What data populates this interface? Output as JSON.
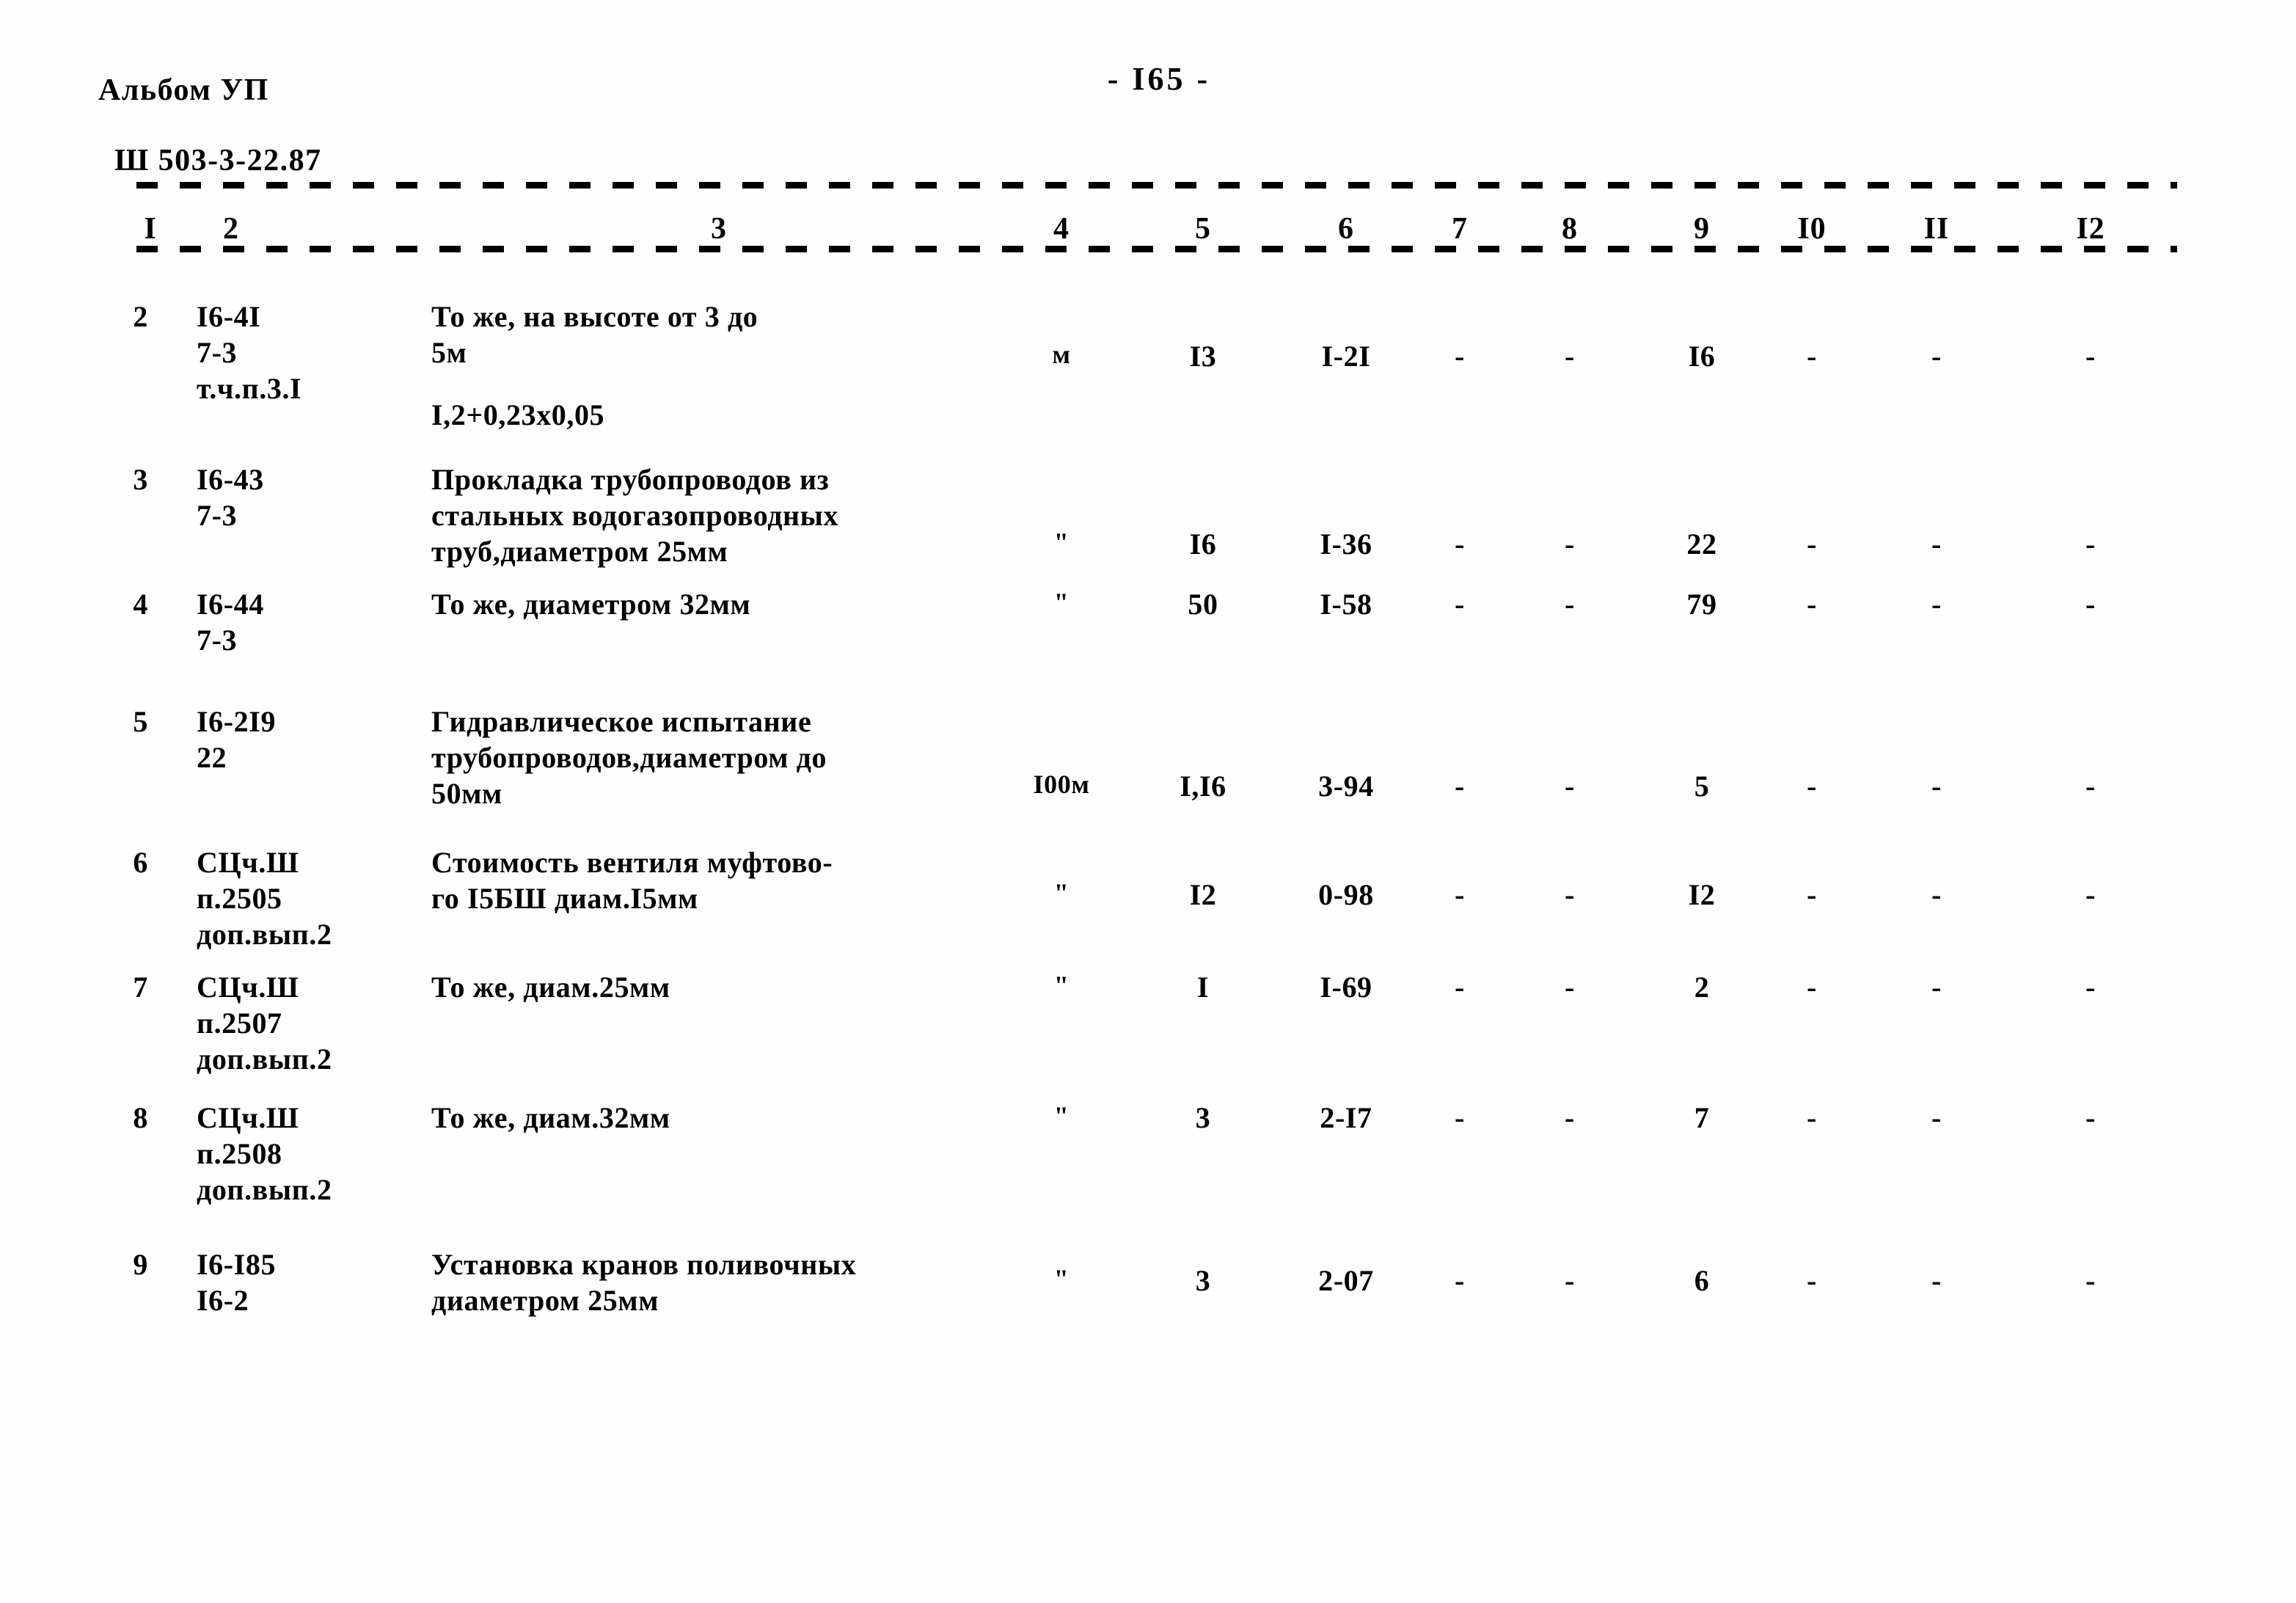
{
  "header": {
    "album_line_1": "Альбом УП",
    "album_line_2": "Ш 503-3-22.87",
    "page_number": "- I65 -"
  },
  "table": {
    "column_headers": [
      "I",
      "2",
      "3",
      "4",
      "5",
      "6",
      "7",
      "8",
      "9",
      "I0",
      "II",
      "I2"
    ],
    "rows": [
      {
        "num": "2",
        "code": "I6-4I\n7-3\nт.ч.п.3.I",
        "desc": "То же, на высоте от 3 до\n5м",
        "extra": "I,2+0,23x0,05",
        "unit": "м",
        "c5": "I3",
        "c6": "I-2I",
        "c7": "-",
        "c8": "-",
        "c9": "I6",
        "c10": "-",
        "c11": "-",
        "c12": "-"
      },
      {
        "num": "3",
        "code": "I6-43\n7-3",
        "desc": "Прокладка трубопроводов из\nстальных водогазопроводных\nтруб,диаметром 25мм",
        "extra": "",
        "unit": "\"",
        "c5": "I6",
        "c6": "I-36",
        "c7": "-",
        "c8": "-",
        "c9": "22",
        "c10": "-",
        "c11": "-",
        "c12": "-"
      },
      {
        "num": "4",
        "code": "I6-44\n7-3",
        "desc": "То же, диаметром 32мм",
        "extra": "",
        "unit": "\"",
        "c5": "50",
        "c6": "I-58",
        "c7": "-",
        "c8": "-",
        "c9": "79",
        "c10": "-",
        "c11": "-",
        "c12": "-"
      },
      {
        "num": "5",
        "code": "I6-2I9\n22",
        "desc": "Гидравлическое испытание\nтрубопроводов,диаметром до\n50мм",
        "extra": "",
        "unit": "I00м",
        "c5": "I,I6",
        "c6": "3-94",
        "c7": "-",
        "c8": "-",
        "c9": "5",
        "c10": "-",
        "c11": "-",
        "c12": "-"
      },
      {
        "num": "6",
        "code": "СЦч.Ш\nп.2505\nдоп.вып.2",
        "desc": "Стоимость вентиля муфтово-\nго I5БШ диам.I5мм",
        "extra": "",
        "unit": "\"",
        "c5": "I2",
        "c6": "0-98",
        "c7": "-",
        "c8": "-",
        "c9": "I2",
        "c10": "-",
        "c11": "-",
        "c12": "-"
      },
      {
        "num": "7",
        "code": "СЦч.Ш\nп.2507\nдоп.вып.2",
        "desc": "То же, диам.25мм",
        "extra": "",
        "unit": "\"",
        "c5": "I",
        "c6": "I-69",
        "c7": "-",
        "c8": "-",
        "c9": "2",
        "c10": "-",
        "c11": "-",
        "c12": "-"
      },
      {
        "num": "8",
        "code": "СЦч.Ш\nп.2508\nдоп.вып.2",
        "desc": "То же, диам.32мм",
        "extra": "",
        "unit": "\"",
        "c5": "3",
        "c6": "2-I7",
        "c7": "-",
        "c8": "-",
        "c9": "7",
        "c10": "-",
        "c11": "-",
        "c12": "-"
      },
      {
        "num": "9",
        "code": "I6-I85\nI6-2",
        "desc": "Установка кранов поливочных\nдиаметром 25мм",
        "extra": "",
        "unit": "\"",
        "c5": "3",
        "c6": "2-07",
        "c7": "-",
        "c8": "-",
        "c9": "6",
        "c10": "-",
        "c11": "-",
        "c12": "-"
      }
    ]
  }
}
